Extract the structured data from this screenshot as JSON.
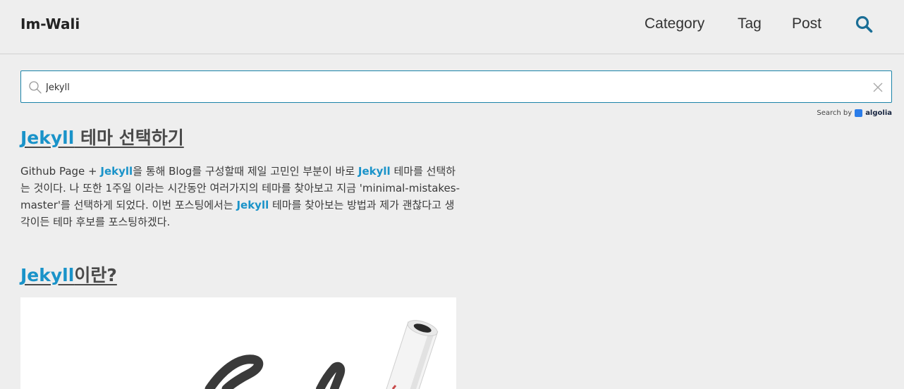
{
  "header": {
    "brand": "Im-Wali",
    "nav": [
      "Category",
      "Tag",
      "Post"
    ],
    "search_icon": "search-icon"
  },
  "search": {
    "value": "Jekyll",
    "icons": {
      "left": "magnifier-icon",
      "clear": "close-icon"
    },
    "powered_by": "Search by",
    "provider": "algolia"
  },
  "results": [
    {
      "title_highlight": "Jekyll",
      "title_rest": " 테마 선택하기",
      "excerpt": [
        {
          "t": "Github Page + ",
          "hl": false
        },
        {
          "t": "Jekyll",
          "hl": true
        },
        {
          "t": "을 통해 Blog를 구성할때 제일 고민인 부분이 바로 ",
          "hl": false
        },
        {
          "t": "Jekyll",
          "hl": true
        },
        {
          "t": " 테마를 선택하는 것이다. 나 또한 1주일 이라는 시간동안 여러가지의 테마를 찾아보고 지금 'minimal-mistakes-master'를 선택하게 되었다. 이번 포스팅에서는 ",
          "hl": false
        },
        {
          "t": "Jekyll",
          "hl": true
        },
        {
          "t": " 테마를 찾아보는 방법과 제가 괜찮다고 생각이든 테마 후보를 포스팅하겠다.",
          "hl": false
        }
      ]
    },
    {
      "title_highlight": "Jekyll",
      "title_rest": "이란?"
    }
  ],
  "colors": {
    "background": "#eeeeee",
    "highlight": "#1a93c9",
    "search_border": "#1a83a8",
    "search_icon": "#1a6e96",
    "algolia": "#2b7de9"
  }
}
